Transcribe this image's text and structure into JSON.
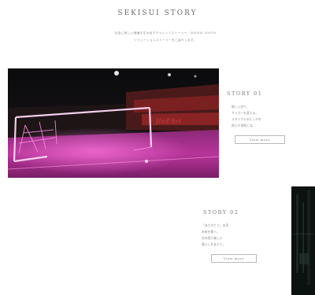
{
  "header": {
    "title": "SEKISUI STORY",
    "intro_line1": "社会に新しい価値を生み出すチャレンジストーリー。SEKISUI YOUTH",
    "intro_line2": "ソリューションストーリーをご紹介します。"
  },
  "story1": {
    "heading": "STORY 01",
    "text_lines": [
      "新しい光で、",
      "サッカーを変える。",
      "スタジアムのピッチを",
      "照らす技術とは。"
    ],
    "button_label": "View more"
  },
  "story2": {
    "heading": "STORY 02",
    "text_lines": [
      "「ありがとう」の声、",
      "未来を繋ぐ。",
      "住み続け楽しい",
      "暮らしを支えて。"
    ],
    "button_label": "View more"
  },
  "colors": {
    "accent_pink": "#e040c8",
    "text_gray": "#7a7a7a",
    "border_gray": "#b8b8b8"
  }
}
